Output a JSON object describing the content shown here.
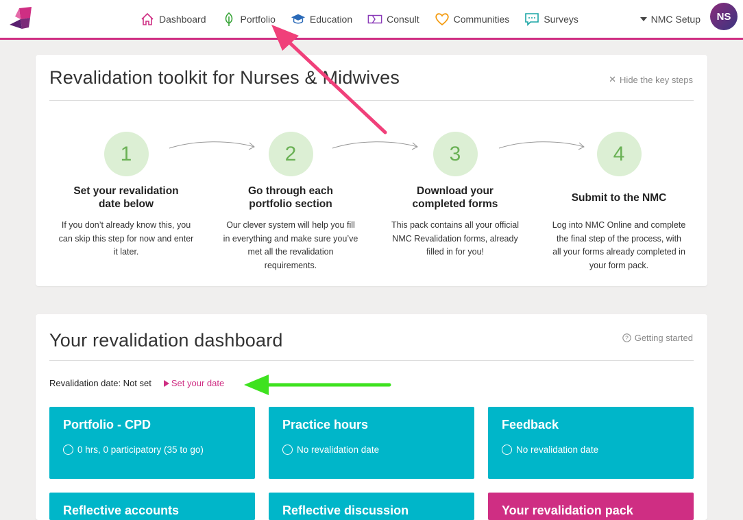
{
  "nav": {
    "items": [
      {
        "label": "Dashboard",
        "icon": "home-icon"
      },
      {
        "label": "Portfolio",
        "icon": "leaf-icon"
      },
      {
        "label": "Education",
        "icon": "graduation-cap-icon"
      },
      {
        "label": "Consult",
        "icon": "ticket-icon"
      },
      {
        "label": "Communities",
        "icon": "heart-icon"
      },
      {
        "label": "Surveys",
        "icon": "chat-bubble-icon"
      }
    ],
    "setup_label": "NMC Setup",
    "avatar_initials": "NS"
  },
  "toolkit": {
    "title": "Revalidation toolkit for Nurses & Midwives",
    "hide_label": "Hide the key steps",
    "steps": [
      {
        "number": "1",
        "title": "Set your revalidation date below",
        "desc": "If you don’t already know this, you can skip this step for now and enter it later."
      },
      {
        "number": "2",
        "title": "Go through each portfolio section",
        "desc": "Our clever system will help you fill in everything and make sure you’ve met all the revalidation requirements."
      },
      {
        "number": "3",
        "title": "Download your completed forms",
        "desc": "This pack contains all your official NMC Revalidation forms, already filled in for you!"
      },
      {
        "number": "4",
        "title": "Submit to the NMC",
        "desc": "Log into NMC Online and complete the final step of the process, with all your forms already completed in your form pack."
      }
    ]
  },
  "dashboard": {
    "title": "Your revalidation dashboard",
    "help_label": "Getting started",
    "date_label": "Revalidation date: Not set",
    "set_date_label": "Set your date",
    "tiles": [
      {
        "title": "Portfolio - CPD",
        "status": "0 hrs, 0 participatory (35 to go)"
      },
      {
        "title": "Practice hours",
        "status": "No revalidation date"
      },
      {
        "title": "Feedback",
        "status": "No revalidation date"
      },
      {
        "title": "Reflective accounts",
        "status": ""
      },
      {
        "title": "Reflective discussion",
        "status": ""
      },
      {
        "title": "Your revalidation pack",
        "status": ""
      }
    ]
  },
  "colors": {
    "brand_pink": "#cf2e83",
    "tile_teal": "#00b6c9",
    "step_green": "#dcefd4",
    "annotation_pink_arrow": "#f0407a",
    "annotation_green_arrow": "#3ee21f"
  }
}
